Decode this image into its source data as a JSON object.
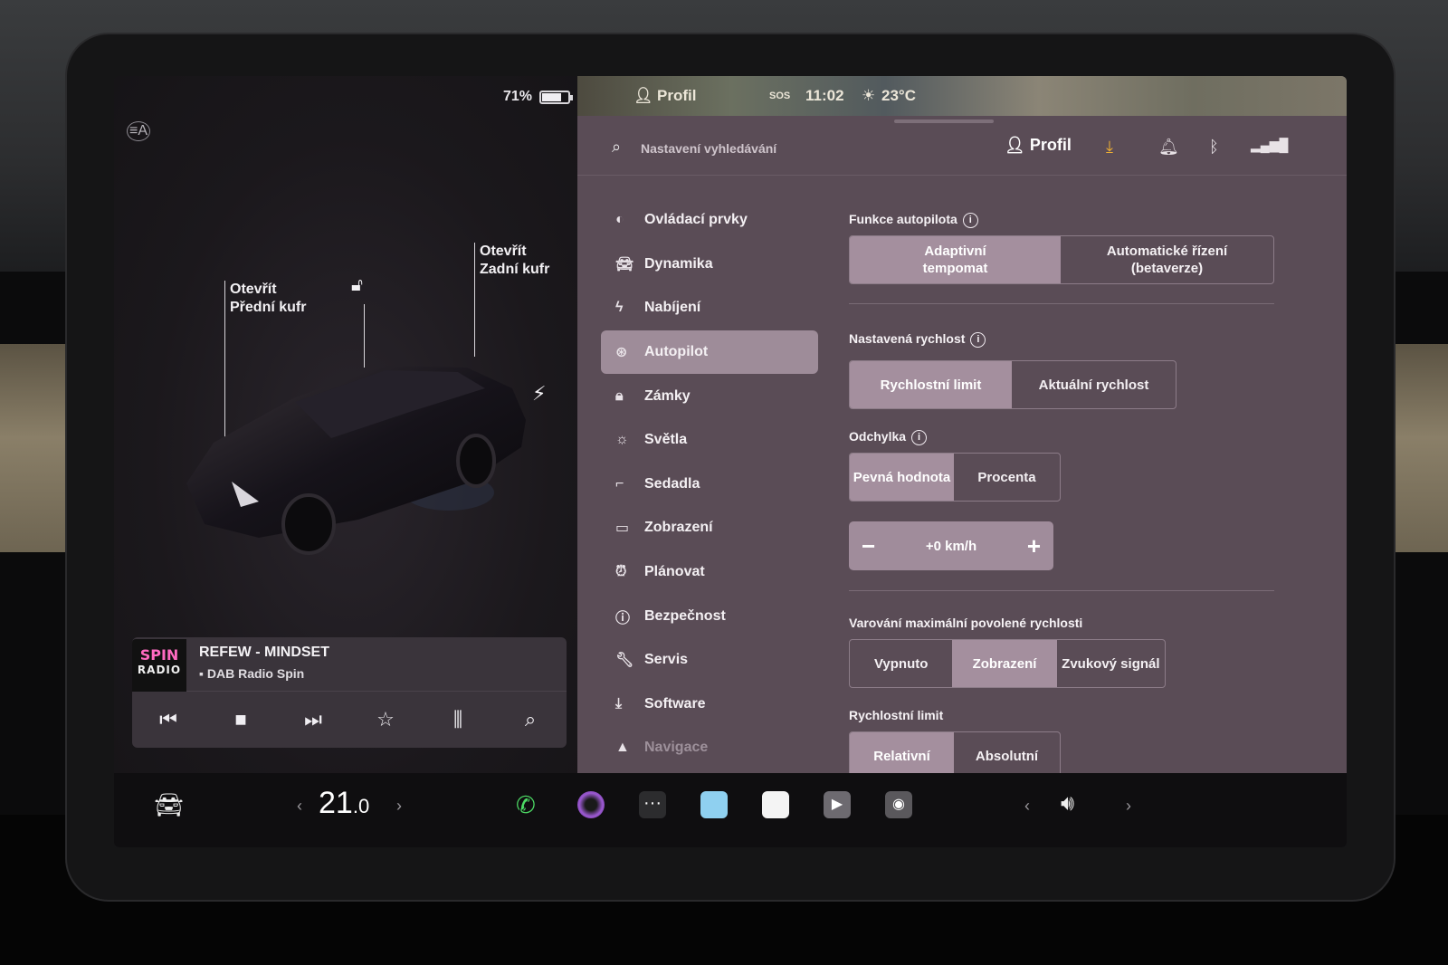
{
  "status": {
    "battery_pct": "71%",
    "battery_level": 0.71,
    "profile": "Profil",
    "time": "11:02",
    "temperature": "23°C",
    "sos": "SOS"
  },
  "car": {
    "front_trunk_line1": "Otevřít",
    "front_trunk_line2": "Přední kufr",
    "rear_trunk_line1": "Otevřít",
    "rear_trunk_line2": "Zadní kufr"
  },
  "media": {
    "logo_line1": "SPIN",
    "logo_line2": "RADIO",
    "song": "REFEW - MINDSET",
    "station": "DAB Radio Spin"
  },
  "topbar": {
    "search_placeholder": "Nastavení vyhledávání",
    "profile_label": "Profil"
  },
  "nav": {
    "items": [
      {
        "label": "Ovládací prvky",
        "icon": "toggle-icon"
      },
      {
        "label": "Dynamika",
        "icon": "car-icon"
      },
      {
        "label": "Nabíjení",
        "icon": "bolt-icon"
      },
      {
        "label": "Autopilot",
        "icon": "steering-wheel-icon"
      },
      {
        "label": "Zámky",
        "icon": "lock-icon"
      },
      {
        "label": "Světla",
        "icon": "sun-icon"
      },
      {
        "label": "Sedadla",
        "icon": "seat-icon"
      },
      {
        "label": "Zobrazení",
        "icon": "display-icon"
      },
      {
        "label": "Plánovat",
        "icon": "alarm-icon"
      },
      {
        "label": "Bezpečnost",
        "icon": "alert-icon"
      },
      {
        "label": "Servis",
        "icon": "wrench-icon"
      },
      {
        "label": "Software",
        "icon": "download-icon"
      },
      {
        "label": "Navigace",
        "icon": "navigation-icon"
      }
    ]
  },
  "autopilot": {
    "features_title": "Funkce autopilota",
    "features_opt1_l1": "Adaptivní",
    "features_opt1_l2": "tempomat",
    "features_opt2_l1": "Automatické řízení",
    "features_opt2_l2": "(betaverze)",
    "set_speed_title": "Nastavená rychlost",
    "set_speed_opt1": "Rychlostní limit",
    "set_speed_opt2": "Aktuální rychlost",
    "offset_title": "Odchylka",
    "offset_opt1": "Pevná hodnota",
    "offset_opt2": "Procenta",
    "offset_value": "+0 km/h",
    "warning_title": "Varování maximální povolené rychlosti",
    "warning_opt1": "Vypnuto",
    "warning_opt2": "Zobrazení",
    "warning_opt3": "Zvukový signál",
    "limit_title": "Rychlostní limit",
    "limit_opt1": "Relativní",
    "limit_opt2": "Absolutní"
  },
  "dock": {
    "temp_int": "21",
    "temp_dec": ".0"
  },
  "colors": {
    "panel_bg": "#5a4c56",
    "active_nav": "#9e8c99",
    "selected_segment": "#a48f9e",
    "accent_download": "#f2b233"
  }
}
